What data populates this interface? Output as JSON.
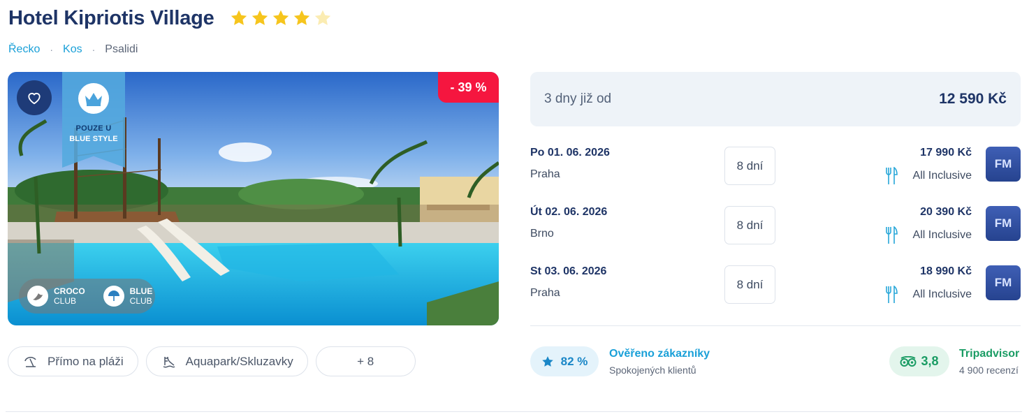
{
  "hotel": {
    "name": "Hotel Kipriotis Village",
    "stars_full": 4,
    "stars_total": 5
  },
  "breadcrumb": [
    {
      "label": "Řecko"
    },
    {
      "label": "Kos"
    },
    {
      "label": "Psalidi"
    }
  ],
  "breadcrumb_separator": "·",
  "photo": {
    "discount": "- 39 %",
    "exclusive_line1": "POUZE U",
    "exclusive_line2": "BLUE STYLE",
    "clubs": [
      {
        "line1": "CROCO",
        "line2": "CLUB",
        "icon": "croco-icon"
      },
      {
        "line1": "BLUE",
        "line2": "CLUB",
        "icon": "umbrella-icon"
      }
    ]
  },
  "features": [
    {
      "label": "Přímo na pláži",
      "icon": "beach-umbrella-icon"
    },
    {
      "label": "Aquapark/Skluzavky",
      "icon": "waterslide-icon"
    },
    {
      "label": "+ 8"
    }
  ],
  "price_summary": {
    "label": "3 dny již od",
    "value": "12 590 Kč"
  },
  "terms": [
    {
      "date": "Po 01. 06. 2026",
      "city": "Praha",
      "days": "8 dní",
      "price": "17 990 Kč",
      "meal": "All Inclusive",
      "badge": "FM"
    },
    {
      "date": "Út 02. 06. 2026",
      "city": "Brno",
      "days": "8 dní",
      "price": "20 390 Kč",
      "meal": "All Inclusive",
      "badge": "FM"
    },
    {
      "date": "St 03. 06. 2026",
      "city": "Praha",
      "days": "8 dní",
      "price": "18 990 Kč",
      "meal": "All Inclusive",
      "badge": "FM"
    }
  ],
  "rating": {
    "value": "82 %",
    "title": "Ověřeno zákazníky",
    "subtitle": "Spokojených klientů"
  },
  "tripadvisor": {
    "value": "3,8",
    "title": "Tripadvisor",
    "subtitle": "4 900 recenzí"
  },
  "colors": {
    "brand_navy": "#1e3466",
    "accent_blue": "#1aa0d8",
    "discount_red": "#f5163f",
    "star_yellow": "#f6c51d",
    "tripadvisor_green": "#1a9c64"
  }
}
